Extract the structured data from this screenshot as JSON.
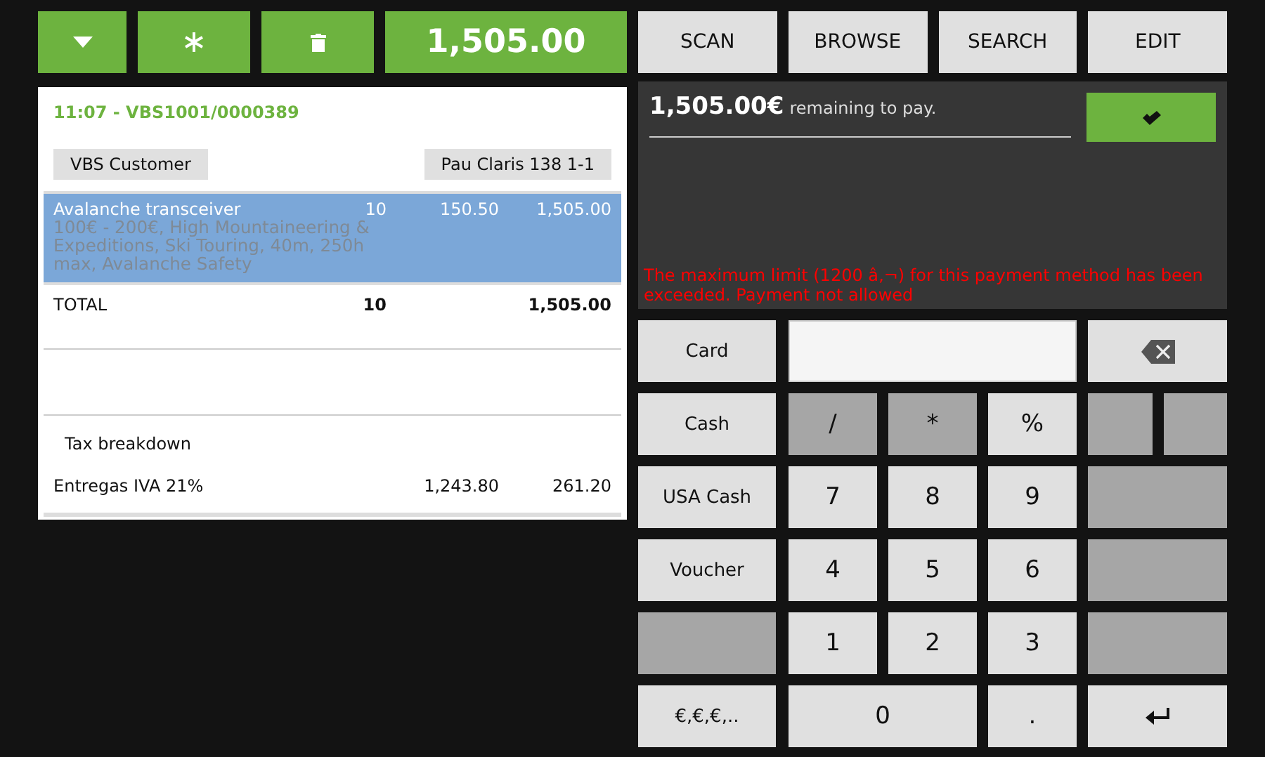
{
  "toolbar": {
    "buttons": [
      {
        "kind": "caret"
      },
      {
        "kind": "asterisk"
      },
      {
        "kind": "trash"
      }
    ],
    "total": "1,505.00"
  },
  "actions": [
    "SCAN",
    "BROWSE",
    "SEARCH",
    "EDIT"
  ],
  "receipt": {
    "header": "11:07 - VBS1001/0000389",
    "customer": "VBS Customer",
    "location": "Pau Claris 138 1-1",
    "lines": [
      {
        "name": "Avalanche transceiver",
        "description": "100€ - 200€, High Mountaineering & Expeditions, Ski Touring, 40m, 250h max, Avalanche Safety",
        "quantity": "10",
        "price": "150.50",
        "amount": "1,505.00",
        "selected": true
      }
    ],
    "total": {
      "label": "TOTAL",
      "quantity": "10",
      "amount": "1,505.00"
    },
    "tax_title": "Tax breakdown",
    "taxes": [
      {
        "name": "Entregas IVA 21%",
        "base": "1,243.80",
        "amount": "261.20"
      }
    ]
  },
  "payment": {
    "amount": "1,505.00€",
    "remaining": "remaining to pay.",
    "error": "The maximum limit (1200 â‚¬) for this payment method has been exceeded. Payment not allowed"
  },
  "methods": [
    {
      "label": "Card",
      "disabled": false
    },
    {
      "label": "Cash",
      "disabled": false
    },
    {
      "label": "USA Cash",
      "disabled": false
    },
    {
      "label": "Voucher",
      "disabled": false
    },
    {
      "disabled": true
    },
    {
      "label": "€,€,€,..",
      "disabled": false
    }
  ],
  "keys": [
    {
      "kind": "input"
    },
    {
      "kind": "backspace",
      "disabled": false
    },
    {
      "kind": "key",
      "label": "/",
      "disabled": true
    },
    {
      "kind": "key",
      "label": "*",
      "disabled": true
    },
    {
      "kind": "key",
      "label": "%",
      "disabled": false
    },
    {
      "kind": "half",
      "disabled": true
    },
    {
      "kind": "half",
      "disabled": true
    },
    {
      "kind": "key",
      "label": "7",
      "disabled": false
    },
    {
      "kind": "key",
      "label": "8",
      "disabled": false
    },
    {
      "kind": "key",
      "label": "9",
      "disabled": false
    },
    {
      "kind": "wide",
      "disabled": true
    },
    {
      "kind": "key",
      "label": "4",
      "disabled": false
    },
    {
      "kind": "key",
      "label": "5",
      "disabled": false
    },
    {
      "kind": "key",
      "label": "6",
      "disabled": false
    },
    {
      "kind": "wide",
      "disabled": true
    },
    {
      "kind": "key",
      "label": "1",
      "disabled": false
    },
    {
      "kind": "key",
      "label": "2",
      "disabled": false
    },
    {
      "kind": "key",
      "label": "3",
      "disabled": false
    },
    {
      "kind": "wide",
      "disabled": true
    },
    {
      "kind": "wide",
      "label": "0",
      "disabled": false
    },
    {
      "kind": "key",
      "label": ".",
      "disabled": false
    },
    {
      "kind": "enter",
      "disabled": false
    }
  ]
}
